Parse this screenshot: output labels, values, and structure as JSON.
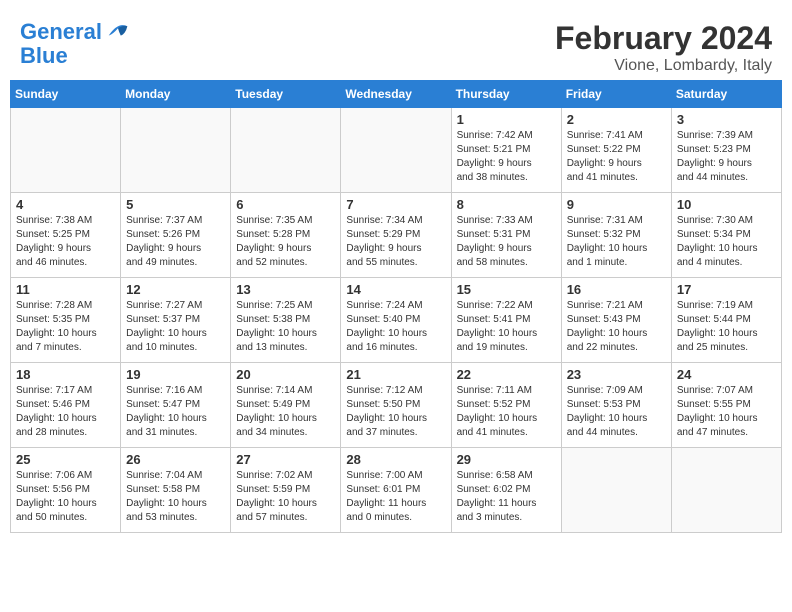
{
  "header": {
    "logo_line1": "General",
    "logo_line2": "Blue",
    "main_title": "February 2024",
    "subtitle": "Vione, Lombardy, Italy"
  },
  "calendar": {
    "days_of_week": [
      "Sunday",
      "Monday",
      "Tuesday",
      "Wednesday",
      "Thursday",
      "Friday",
      "Saturday"
    ],
    "weeks": [
      [
        {
          "day": "",
          "info": ""
        },
        {
          "day": "",
          "info": ""
        },
        {
          "day": "",
          "info": ""
        },
        {
          "day": "",
          "info": ""
        },
        {
          "day": "1",
          "info": "Sunrise: 7:42 AM\nSunset: 5:21 PM\nDaylight: 9 hours\nand 38 minutes."
        },
        {
          "day": "2",
          "info": "Sunrise: 7:41 AM\nSunset: 5:22 PM\nDaylight: 9 hours\nand 41 minutes."
        },
        {
          "day": "3",
          "info": "Sunrise: 7:39 AM\nSunset: 5:23 PM\nDaylight: 9 hours\nand 44 minutes."
        }
      ],
      [
        {
          "day": "4",
          "info": "Sunrise: 7:38 AM\nSunset: 5:25 PM\nDaylight: 9 hours\nand 46 minutes."
        },
        {
          "day": "5",
          "info": "Sunrise: 7:37 AM\nSunset: 5:26 PM\nDaylight: 9 hours\nand 49 minutes."
        },
        {
          "day": "6",
          "info": "Sunrise: 7:35 AM\nSunset: 5:28 PM\nDaylight: 9 hours\nand 52 minutes."
        },
        {
          "day": "7",
          "info": "Sunrise: 7:34 AM\nSunset: 5:29 PM\nDaylight: 9 hours\nand 55 minutes."
        },
        {
          "day": "8",
          "info": "Sunrise: 7:33 AM\nSunset: 5:31 PM\nDaylight: 9 hours\nand 58 minutes."
        },
        {
          "day": "9",
          "info": "Sunrise: 7:31 AM\nSunset: 5:32 PM\nDaylight: 10 hours\nand 1 minute."
        },
        {
          "day": "10",
          "info": "Sunrise: 7:30 AM\nSunset: 5:34 PM\nDaylight: 10 hours\nand 4 minutes."
        }
      ],
      [
        {
          "day": "11",
          "info": "Sunrise: 7:28 AM\nSunset: 5:35 PM\nDaylight: 10 hours\nand 7 minutes."
        },
        {
          "day": "12",
          "info": "Sunrise: 7:27 AM\nSunset: 5:37 PM\nDaylight: 10 hours\nand 10 minutes."
        },
        {
          "day": "13",
          "info": "Sunrise: 7:25 AM\nSunset: 5:38 PM\nDaylight: 10 hours\nand 13 minutes."
        },
        {
          "day": "14",
          "info": "Sunrise: 7:24 AM\nSunset: 5:40 PM\nDaylight: 10 hours\nand 16 minutes."
        },
        {
          "day": "15",
          "info": "Sunrise: 7:22 AM\nSunset: 5:41 PM\nDaylight: 10 hours\nand 19 minutes."
        },
        {
          "day": "16",
          "info": "Sunrise: 7:21 AM\nSunset: 5:43 PM\nDaylight: 10 hours\nand 22 minutes."
        },
        {
          "day": "17",
          "info": "Sunrise: 7:19 AM\nSunset: 5:44 PM\nDaylight: 10 hours\nand 25 minutes."
        }
      ],
      [
        {
          "day": "18",
          "info": "Sunrise: 7:17 AM\nSunset: 5:46 PM\nDaylight: 10 hours\nand 28 minutes."
        },
        {
          "day": "19",
          "info": "Sunrise: 7:16 AM\nSunset: 5:47 PM\nDaylight: 10 hours\nand 31 minutes."
        },
        {
          "day": "20",
          "info": "Sunrise: 7:14 AM\nSunset: 5:49 PM\nDaylight: 10 hours\nand 34 minutes."
        },
        {
          "day": "21",
          "info": "Sunrise: 7:12 AM\nSunset: 5:50 PM\nDaylight: 10 hours\nand 37 minutes."
        },
        {
          "day": "22",
          "info": "Sunrise: 7:11 AM\nSunset: 5:52 PM\nDaylight: 10 hours\nand 41 minutes."
        },
        {
          "day": "23",
          "info": "Sunrise: 7:09 AM\nSunset: 5:53 PM\nDaylight: 10 hours\nand 44 minutes."
        },
        {
          "day": "24",
          "info": "Sunrise: 7:07 AM\nSunset: 5:55 PM\nDaylight: 10 hours\nand 47 minutes."
        }
      ],
      [
        {
          "day": "25",
          "info": "Sunrise: 7:06 AM\nSunset: 5:56 PM\nDaylight: 10 hours\nand 50 minutes."
        },
        {
          "day": "26",
          "info": "Sunrise: 7:04 AM\nSunset: 5:58 PM\nDaylight: 10 hours\nand 53 minutes."
        },
        {
          "day": "27",
          "info": "Sunrise: 7:02 AM\nSunset: 5:59 PM\nDaylight: 10 hours\nand 57 minutes."
        },
        {
          "day": "28",
          "info": "Sunrise: 7:00 AM\nSunset: 6:01 PM\nDaylight: 11 hours\nand 0 minutes."
        },
        {
          "day": "29",
          "info": "Sunrise: 6:58 AM\nSunset: 6:02 PM\nDaylight: 11 hours\nand 3 minutes."
        },
        {
          "day": "",
          "info": ""
        },
        {
          "day": "",
          "info": ""
        }
      ]
    ]
  }
}
